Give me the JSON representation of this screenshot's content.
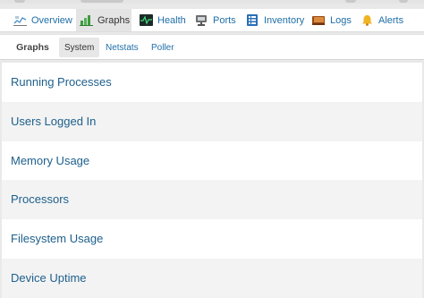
{
  "main_tabs": [
    {
      "label": "Overview",
      "icon": "overview-chart-icon",
      "active": false
    },
    {
      "label": "Graphs",
      "icon": "graphs-bar-icon",
      "active": true
    },
    {
      "label": "Health",
      "icon": "health-monitor-icon",
      "active": false
    },
    {
      "label": "Ports",
      "icon": "ports-network-icon",
      "active": false
    },
    {
      "label": "Inventory",
      "icon": "inventory-list-icon",
      "active": false
    },
    {
      "label": "Logs",
      "icon": "logs-book-icon",
      "active": false
    },
    {
      "label": "Alerts",
      "icon": "alerts-bell-icon",
      "active": false
    }
  ],
  "sub_nav": {
    "title": "Graphs",
    "tabs": [
      {
        "label": "System",
        "active": true
      },
      {
        "label": "Netstats",
        "active": false
      },
      {
        "label": "Poller",
        "active": false
      }
    ]
  },
  "graph_sections": [
    {
      "label": "Running Processes"
    },
    {
      "label": "Users Logged In"
    },
    {
      "label": "Memory Usage"
    },
    {
      "label": "Processors"
    },
    {
      "label": "Filesystem Usage"
    },
    {
      "label": "Device Uptime"
    }
  ],
  "colors": {
    "link": "#1f6fa8",
    "section_link": "#1d5f8c",
    "active_tab_bg": "#e4e4e4",
    "alt_row_bg": "#f3f3f3"
  }
}
